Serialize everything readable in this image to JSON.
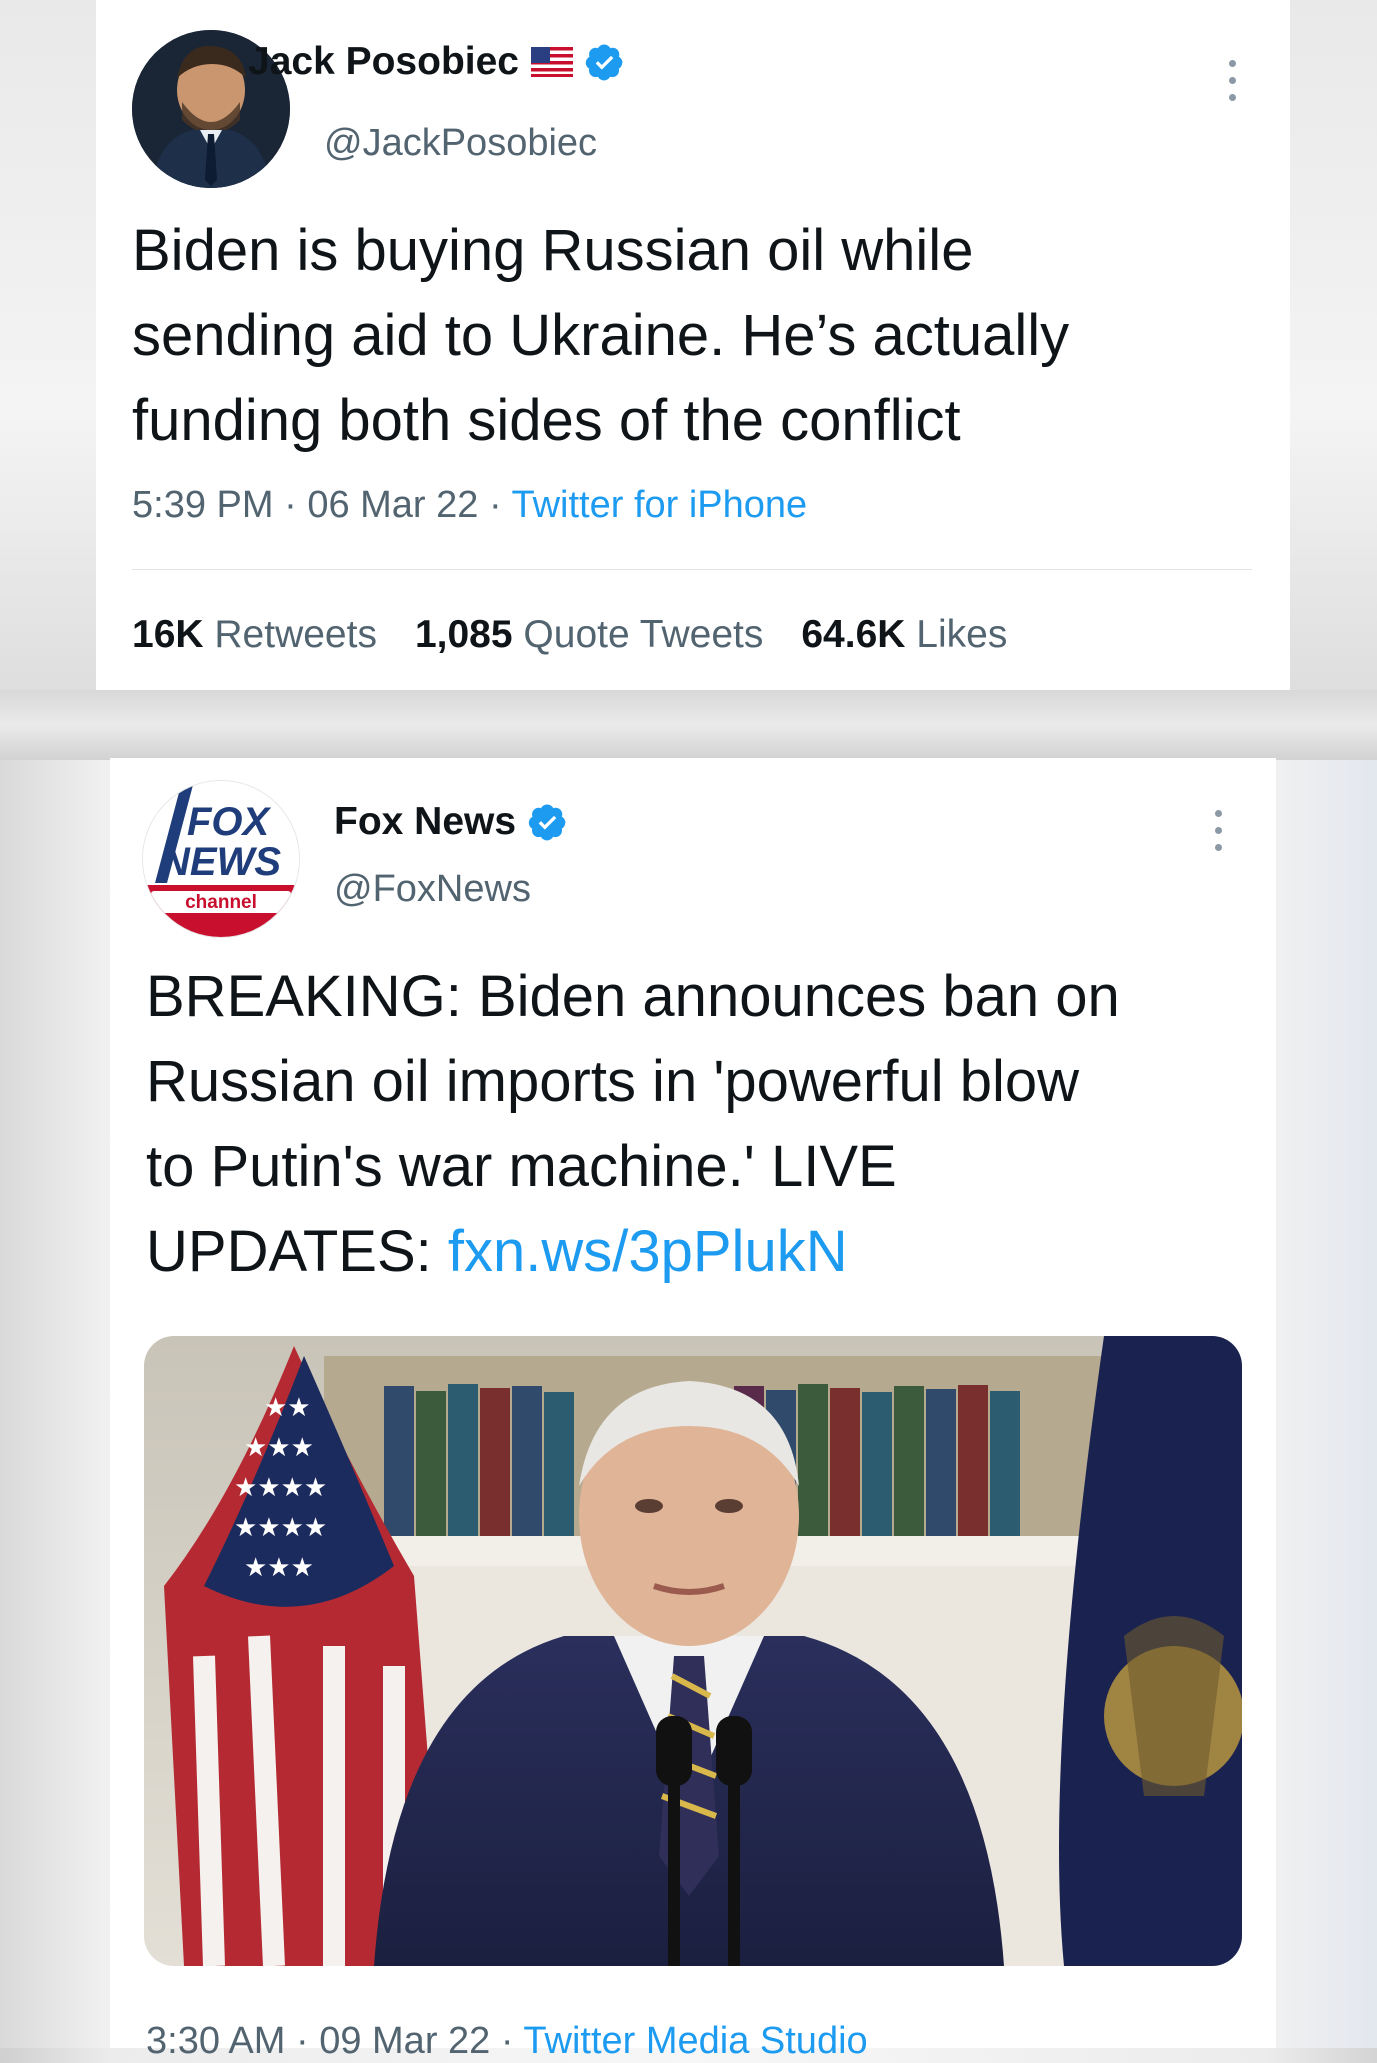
{
  "tweet1": {
    "author_name": "Jack Posobiec",
    "author_handle": "@JackPosobiec",
    "text_lines": [
      "Biden is buying Russian oil while",
      "sending aid to Ukraine. He’s actually",
      "funding both sides of the conflict"
    ],
    "time": "5:39 PM",
    "date": "06 Mar 22",
    "source": "Twitter for iPhone",
    "separator": "·",
    "stats": {
      "retweets_count": "16K",
      "retweets_label": "Retweets",
      "quotes_count": "1,085",
      "quotes_label": "Quote Tweets",
      "likes_count": "64.6K",
      "likes_label": "Likes"
    },
    "icons": {
      "flag": "us-flag-icon",
      "verified": "verified-badge-icon",
      "more": "more-options-icon"
    }
  },
  "tweet2": {
    "author_name": "Fox News",
    "author_handle": "@FoxNews",
    "logo_text": {
      "top": "FOX",
      "middle": "NEWS",
      "bottom": "channel"
    },
    "text_lines": [
      "BREAKING: Biden announces ban on",
      "Russian oil imports in 'powerful blow",
      "to Putin's war machine.' LIVE"
    ],
    "text_last_prefix": "UPDATES: ",
    "link_text": "fxn.ws/3pPlukN",
    "time": "3:30 AM",
    "date": "09 Mar 22",
    "source": "Twitter Media Studio",
    "separator": "·",
    "icons": {
      "verified": "verified-badge-icon",
      "more": "more-options-icon"
    }
  },
  "colors": {
    "link": "#1d9bf0",
    "verified": "#1d9bf0",
    "text": "#0f1419",
    "secondary": "#536471"
  }
}
